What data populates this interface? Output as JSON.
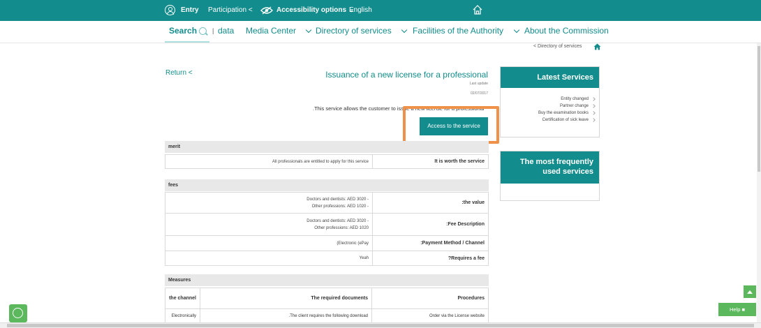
{
  "colors": {
    "accent": "#128c8c",
    "highlight": "#f0914a",
    "help": "#5cb85c"
  },
  "topbar": {
    "entry": "Entry",
    "participation": "Participation",
    "accessibility": "Accessibility options",
    "language": "English"
  },
  "nav": {
    "search": "Search",
    "open_data": "data",
    "media": "Media Center",
    "directory": "Directory of services",
    "facilities": "Facilities of the Authority",
    "about": "About the Commission"
  },
  "breadcrumb": "< Directory of services",
  "return_label": "Return <",
  "service": {
    "title": "Issuance of a new license for a professional",
    "last_update_label": "Last update",
    "last_update_date": "02/07/2017",
    "description": ".This service allows the customer to issue a new license for a professional",
    "access_button": "Access to the service"
  },
  "merit": {
    "heading": "merit",
    "value": "All professionals are entitled to apply for this service",
    "label": "It is worth the service"
  },
  "fees": {
    "heading": "fees",
    "rows": [
      {
        "line1": "Doctors and dentists: AED 3020 -",
        "line2": "Other professions: AED 1020 -",
        "label": ":the value"
      },
      {
        "line1": "Doctors and dentists: AED 3020 -",
        "line2": "Other professions: AED 1020",
        "label": ":Fee Description"
      },
      {
        "line1": "(Electronic (ePay",
        "line2": "",
        "label": ":Payment Method / Channel"
      },
      {
        "line1": "Yeah",
        "line2": "",
        "label": "?Requires a fee"
      }
    ]
  },
  "measures": {
    "heading": "Measures",
    "col_channel": "the channel",
    "col_docs": "The required documents",
    "col_proc": "Procedures",
    "row_channel": "Electronically",
    "row_docs": ".The client requires the following download",
    "row_proc": "Order via the License website"
  },
  "sidebar": {
    "latest_title": "Latest Services",
    "latest_items": [
      "Entity changed",
      "Partner change",
      "Buy the examination books",
      "Certification of sick leave"
    ],
    "frequent_title": "The most frequently used services"
  },
  "help_label": "Help"
}
